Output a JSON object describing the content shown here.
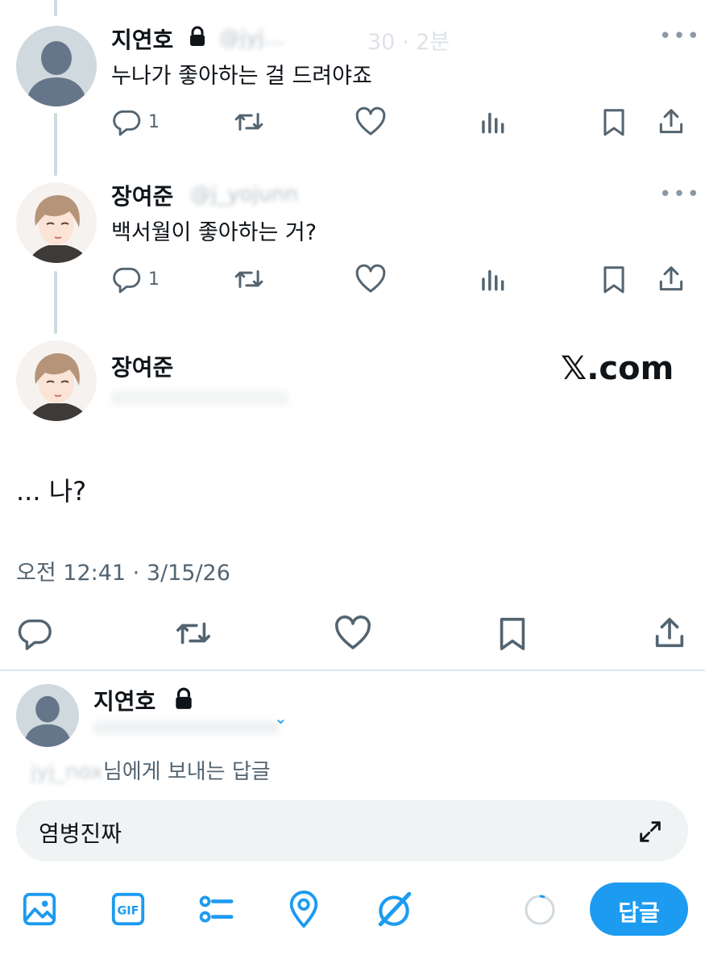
{
  "tweets": [
    {
      "author": "지연호",
      "handle_blurred": "@jyj...",
      "time": "30 · 2분",
      "text": "누나가 좋아하는 걸 드려야죠",
      "replies": "1"
    },
    {
      "author": "장여준",
      "handle_blurred": "@j_yojunn",
      "text": "백서월이 좋아하는 거?",
      "replies": "1"
    }
  ],
  "main_tweet": {
    "author": "장여준",
    "badge": "𝕏.com",
    "text": "... 나?",
    "timestamp": "오전 12:41 · 3/15/26"
  },
  "composer": {
    "author": "지연호",
    "reply_to_suffix": "님에게 보내는 답글",
    "reply_to_blurred": "jyj_nox",
    "input_value": "염병진짜",
    "reply_button": "답글"
  },
  "colors": {
    "accent": "#1d9bf0",
    "muted": "#536471",
    "border": "#cfd9de",
    "input_bg": "#eff3f4"
  },
  "icons": {
    "reply": "reply-icon",
    "retweet": "retweet-icon",
    "like": "heart-icon",
    "views": "views-icon",
    "bookmark": "bookmark-icon",
    "share": "share-icon",
    "lock": "lock-icon"
  }
}
